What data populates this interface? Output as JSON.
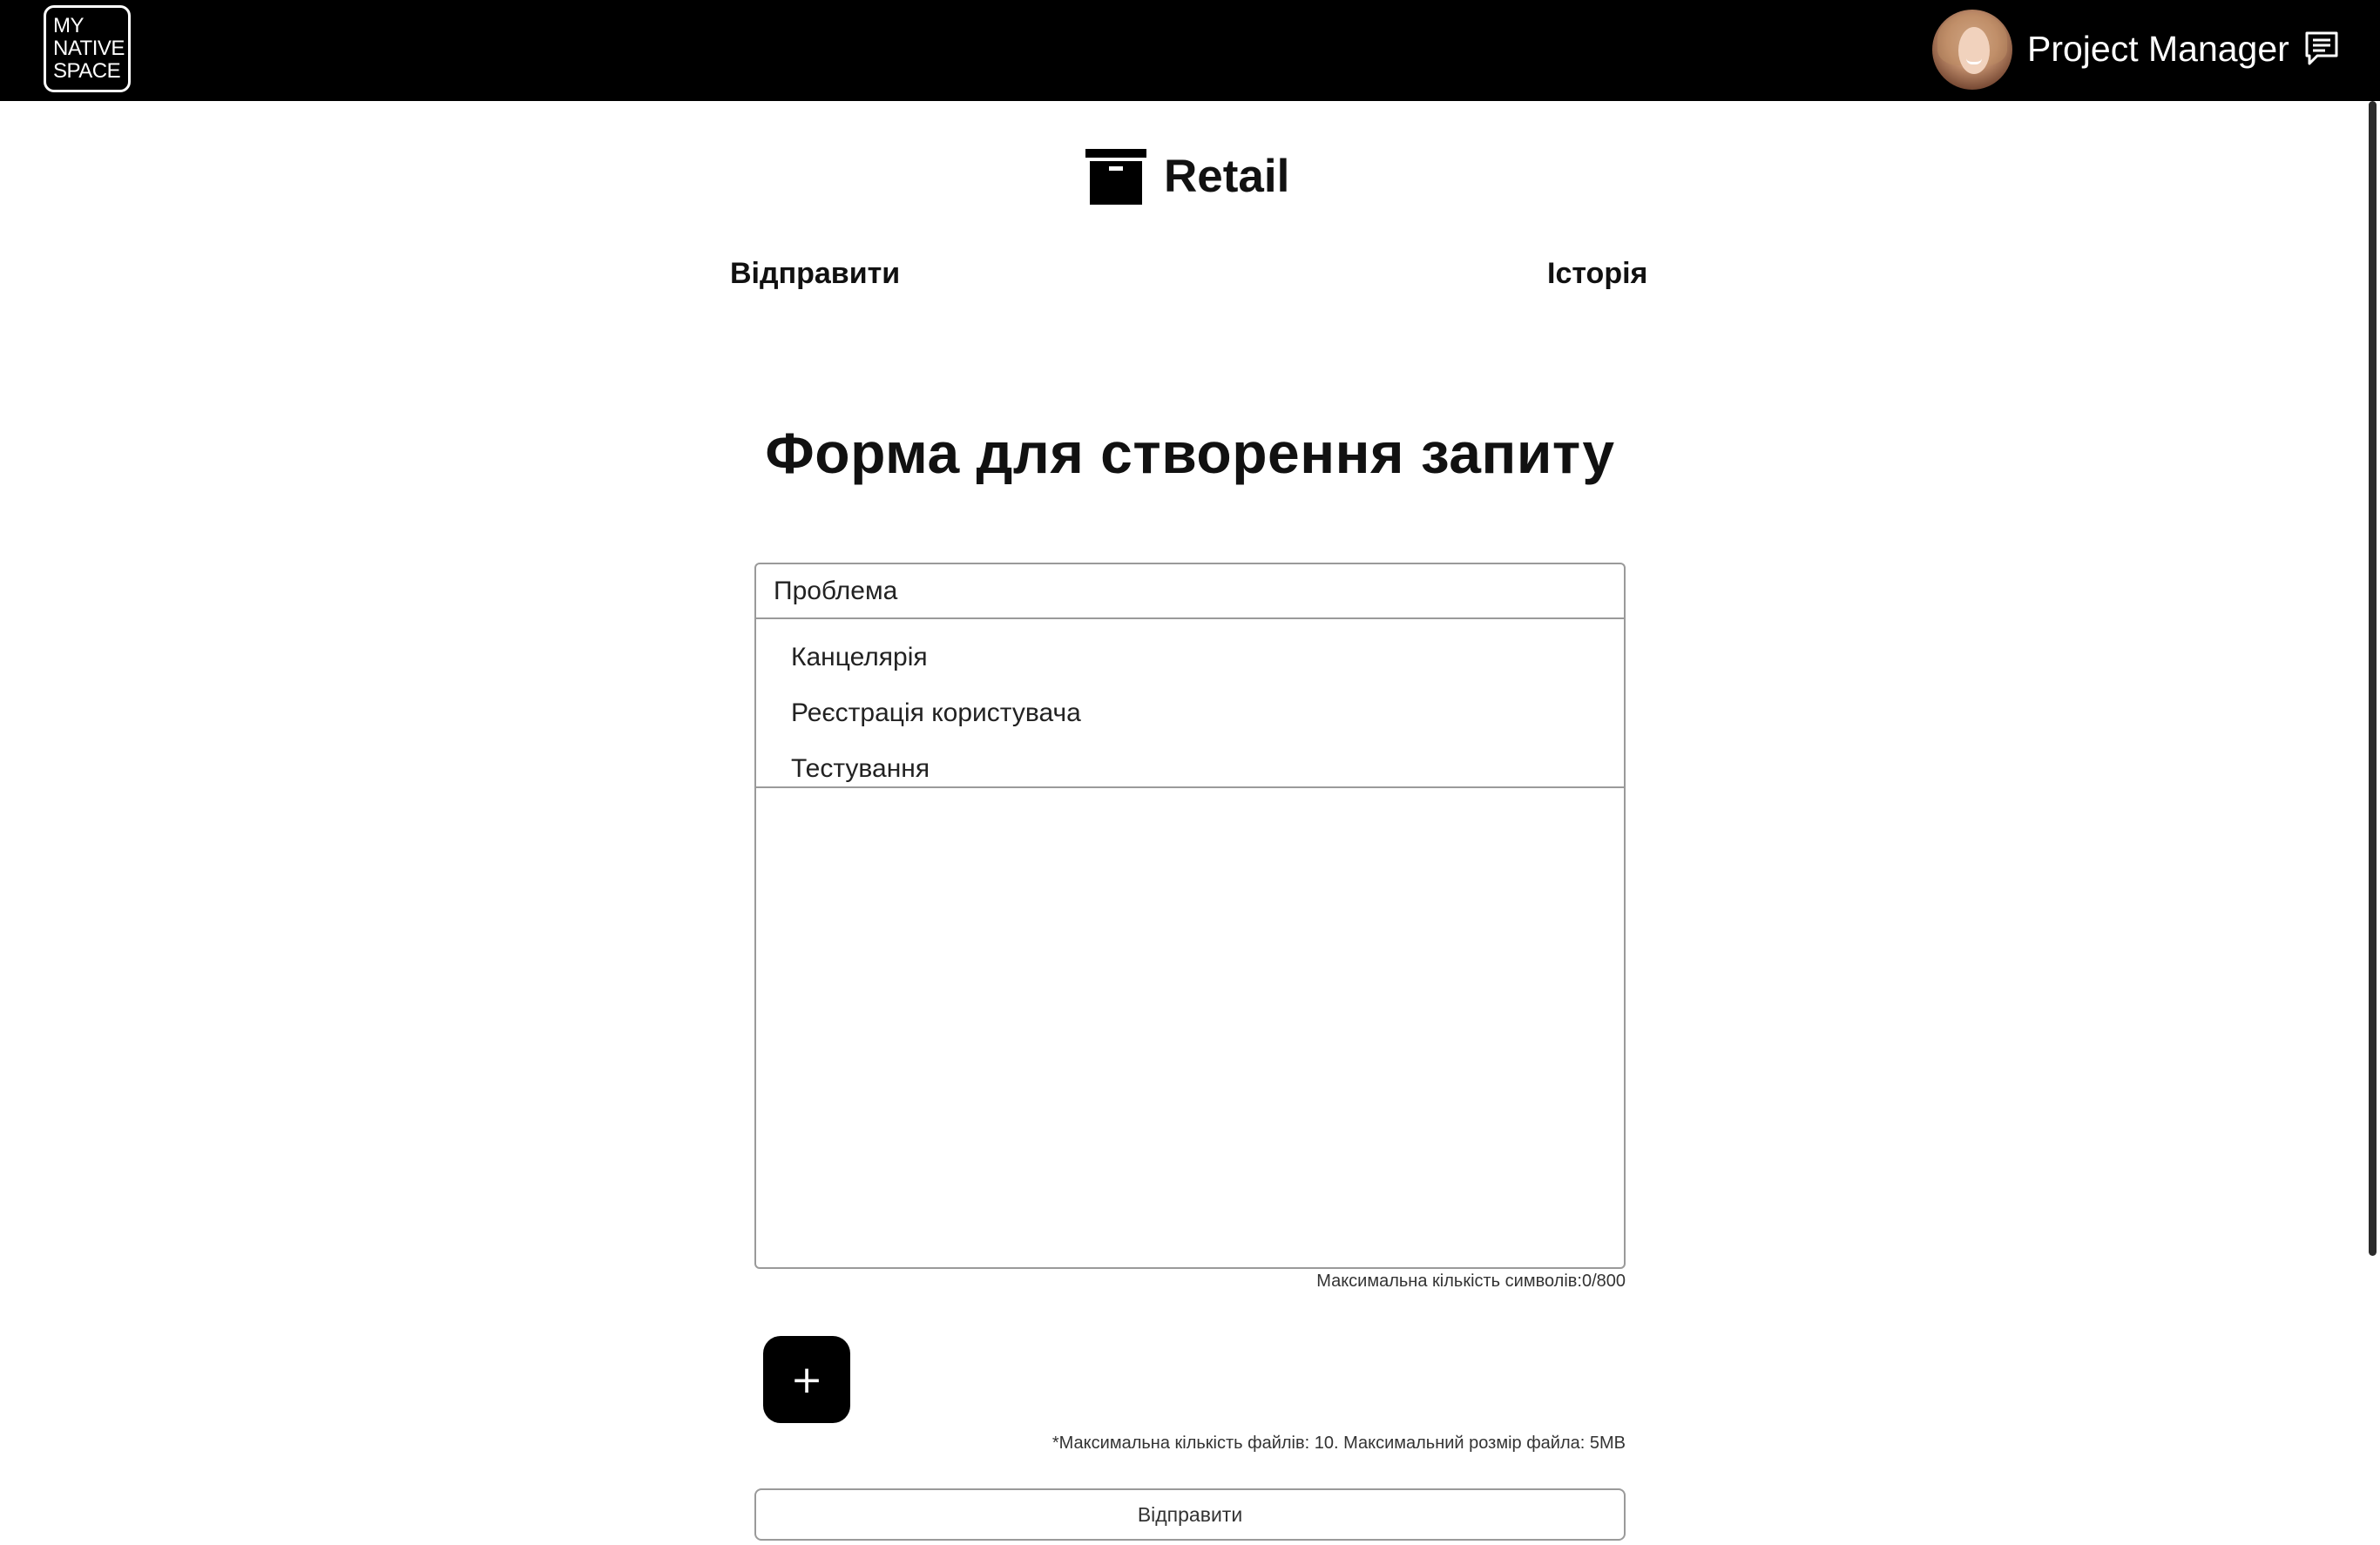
{
  "app": {
    "logo_lines": [
      "MY",
      "NATIVE",
      "SPACE"
    ],
    "brand_icon": "archive-box-icon",
    "user_icon": "avatar",
    "chat_icon": "message-icon"
  },
  "topbar": {
    "role": "Project Manager"
  },
  "header": {
    "title": "Retail"
  },
  "tabs": {
    "send": "Відправити",
    "history": "Історія"
  },
  "page": {
    "title": "Форма для створення запиту"
  },
  "form": {
    "category_select": {
      "value": "Проблема",
      "options": [
        "Канцелярія",
        "Реєстрація користувача",
        "Тестування"
      ]
    },
    "description": {
      "value": ""
    },
    "char_counter": "Максимальна кількість символів:0/800",
    "add_file_label": "+",
    "file_note": "*Максимальна кількість файлів: 10. Максимальний розмір файла: 5MB",
    "submit_label": "Відправити"
  },
  "colors": {
    "topbar_bg": "#000000",
    "border": "#9a9a9a",
    "accent": "#000000"
  }
}
